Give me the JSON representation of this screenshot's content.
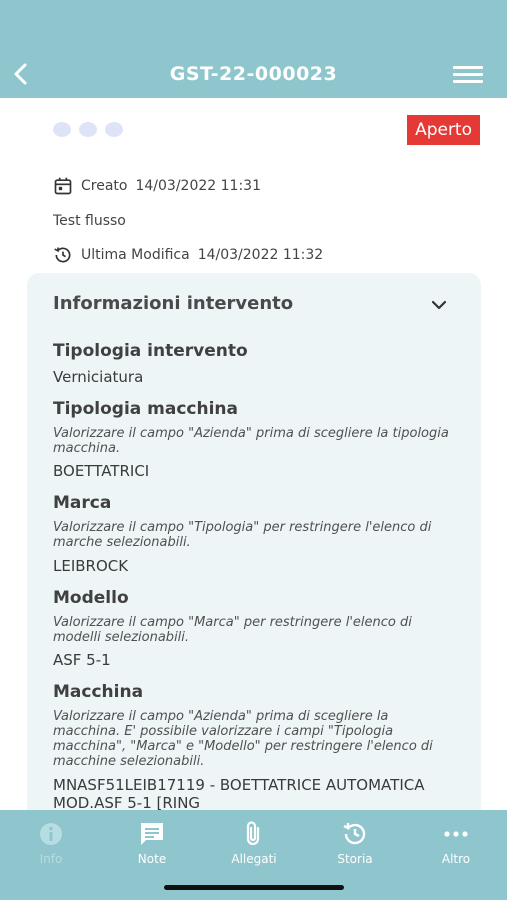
{
  "header": {
    "title": "GST-22-000023",
    "back_icon": "chevron-left-icon",
    "menu_icon": "hamburger-menu-icon"
  },
  "status": {
    "label": "Aperto",
    "color": "#e53935"
  },
  "meta": {
    "created_label": "Creato",
    "created_value": "14/03/2022 11:31",
    "description": "Test flusso",
    "modified_label": "Ultima Modifica",
    "modified_value": "14/03/2022 11:32"
  },
  "section": {
    "title": "Informazioni intervento",
    "fields": [
      {
        "label": "Tipologia intervento",
        "hint": "",
        "value": "Verniciatura"
      },
      {
        "label": "Tipologia macchina",
        "hint": "Valorizzare il campo \"Azienda\" prima di scegliere la tipologia macchina.",
        "value": "BOETTATRICI"
      },
      {
        "label": "Marca",
        "hint": "Valorizzare il campo \"Tipologia\" per restringere l'elenco di marche selezionabili.",
        "value": "LEIBROCK"
      },
      {
        "label": "Modello",
        "hint": "Valorizzare il campo \"Marca\" per restringere l'elenco di modelli selezionabili.",
        "value": "ASF 5-1"
      },
      {
        "label": "Macchina",
        "hint": "Valorizzare il campo \"Azienda\" prima di scegliere la macchina. E' possibile valorizzare i campi \"Tipologia macchina\", \"Marca\" e \"Modello\" per restringere l'elenco di macchine selezionabili.",
        "value": "MNASF51LEIB17119 - BOETTATRICE AUTOMATICA MOD.ASF 5-1 [RING"
      }
    ]
  },
  "tabs": [
    {
      "label": "Info",
      "icon": "info-icon",
      "active": true
    },
    {
      "label": "Note",
      "icon": "note-icon",
      "active": false
    },
    {
      "label": "Allegati",
      "icon": "paperclip-icon",
      "active": false
    },
    {
      "label": "Storia",
      "icon": "history-icon",
      "active": false
    },
    {
      "label": "Altro",
      "icon": "more-icon",
      "active": false
    }
  ],
  "colors": {
    "header_bg": "#8fc6cd",
    "card_bg": "#edf5f6",
    "badge_bg": "#e53935"
  }
}
